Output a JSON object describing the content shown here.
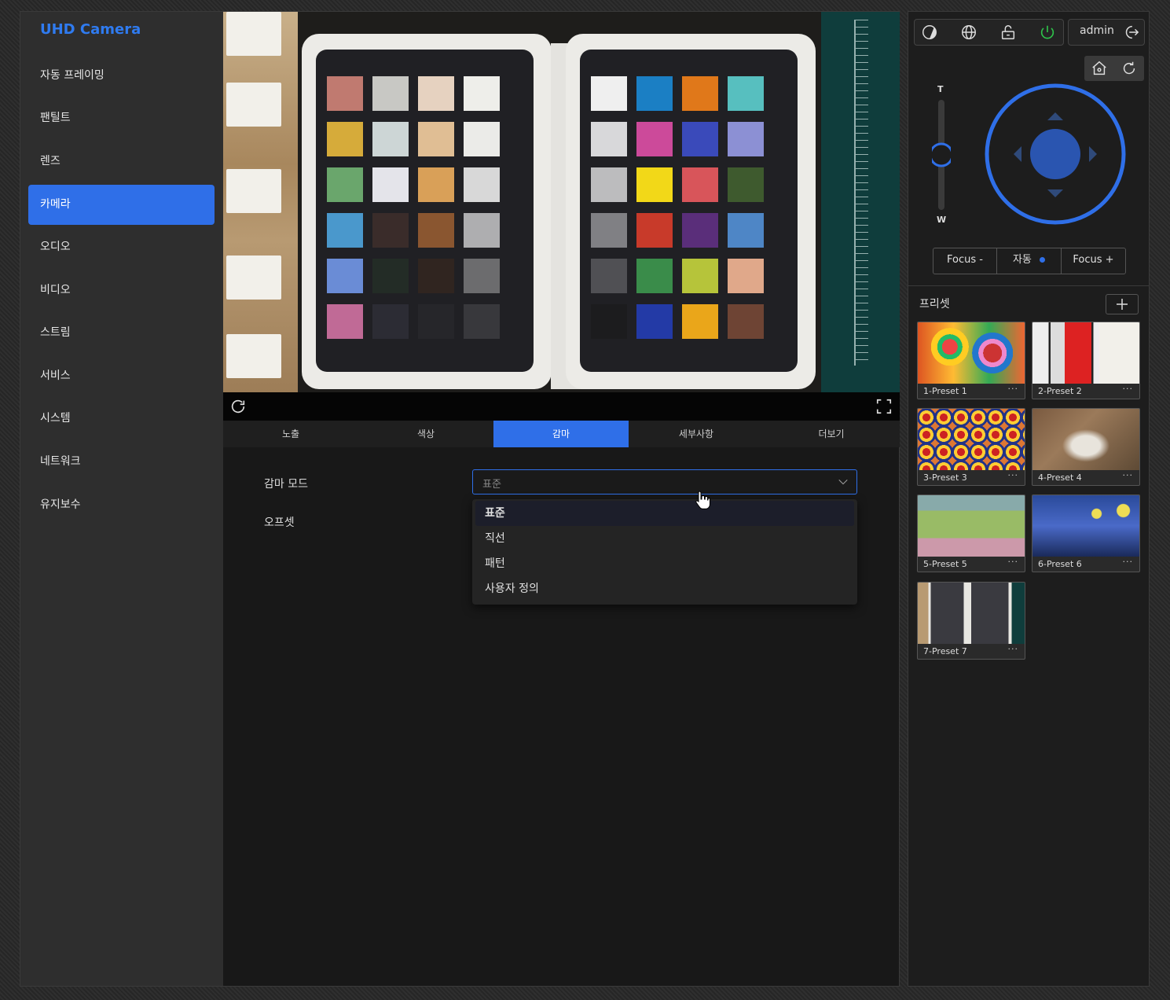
{
  "app": {
    "brand": "UHD Camera"
  },
  "sidebar": {
    "items": [
      {
        "label": "자동 프레이밍"
      },
      {
        "label": "팬틸트"
      },
      {
        "label": "렌즈"
      },
      {
        "label": "카메라",
        "active": true
      },
      {
        "label": "오디오"
      },
      {
        "label": "비디오"
      },
      {
        "label": "스트림"
      },
      {
        "label": "서비스"
      },
      {
        "label": "시스템"
      },
      {
        "label": "네트워크"
      },
      {
        "label": "유지보수"
      }
    ]
  },
  "tabs": [
    {
      "label": "노출"
    },
    {
      "label": "색상"
    },
    {
      "label": "감마",
      "active": true
    },
    {
      "label": "세부사항"
    },
    {
      "label": "더보기"
    }
  ],
  "gamma": {
    "mode_label": "감마 모드",
    "mode_value": "표준",
    "offset_label": "오프셋",
    "options": [
      "표준",
      "직선",
      "패턴",
      "사용자 정의"
    ]
  },
  "header": {
    "user": "admin"
  },
  "zoom": {
    "tele": "T",
    "wide": "W",
    "level": 0.5
  },
  "focus": {
    "minus": "Focus -",
    "auto": "자동",
    "plus": "Focus +"
  },
  "presets": {
    "title": "프리셋",
    "items": [
      {
        "name": "1-Preset 1"
      },
      {
        "name": "2-Preset 2"
      },
      {
        "name": "3-Preset 3"
      },
      {
        "name": "4-Preset 4"
      },
      {
        "name": "5-Preset 5"
      },
      {
        "name": "6-Preset 6"
      },
      {
        "name": "7-Preset 7"
      }
    ],
    "more": "···"
  },
  "colors": {
    "accent": "#2f6fe8",
    "brand": "#2f7bf0",
    "power": "#2ec24a"
  }
}
